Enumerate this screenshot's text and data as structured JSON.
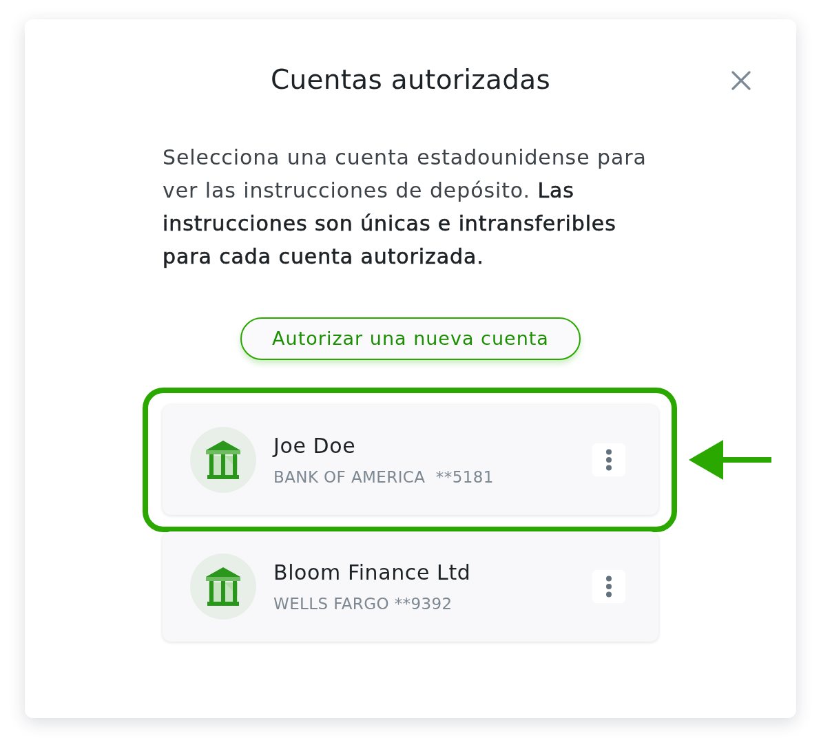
{
  "dialog": {
    "title": "Cuentas autorizadas",
    "description": "Selecciona una cuenta estadounidense para ver las instrucciones de depósito. **Las instrucciones son únicas e intransferibles para cada cuenta autorizada.**"
  },
  "authorize_button": {
    "label": "Autorizar una nueva cuenta"
  },
  "accounts": [
    {
      "name": "Joe Doe",
      "detail": "BANK OF AMERICA  **5181",
      "highlighted": true
    },
    {
      "name": "Bloom Finance Ltd",
      "detail": "WELLS FARGO **9392",
      "highlighted": false
    }
  ]
}
